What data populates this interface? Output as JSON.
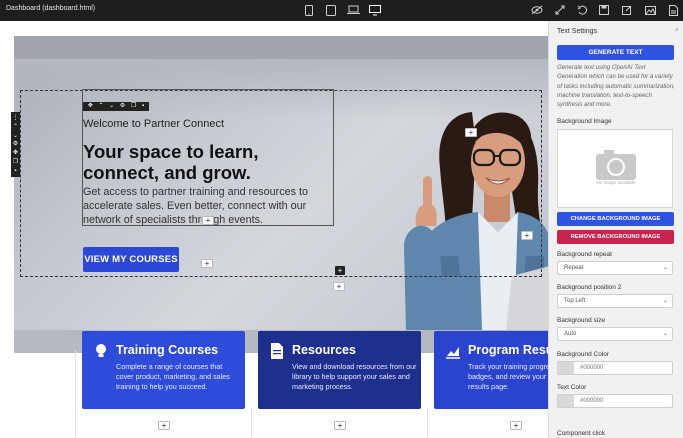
{
  "topbar": {
    "doc_title": "Dashboard (dashboard.html)",
    "device_icons": [
      "mobile-icon",
      "tablet-icon",
      "laptop-icon",
      "desktop-icon"
    ],
    "action_icons": [
      "visibility-icon",
      "fullscreen-icon",
      "undo-icon",
      "save-icon",
      "edit-icon",
      "image-icon",
      "file-icon"
    ]
  },
  "hero": {
    "welcome": "Welcome to Partner Connect",
    "headline": "Your space to learn, connect, and grow.",
    "subtext": "Get access to partner training and resources to accelerate sales. Even better, connect with our network of specialists through events.",
    "cta": "VIEW MY COURSES"
  },
  "cards": [
    {
      "title": "Training Courses",
      "body": "Complete a range of courses that cover product, marketing, and sales training to help you succeed.",
      "icon": "lightbulb-icon",
      "color": "#2f4bd9"
    },
    {
      "title": "Resources",
      "body": "View and download resources from our library to help support your sales and marketing process.",
      "icon": "document-icon",
      "color": "#1f2f8e"
    },
    {
      "title": "Program Results",
      "body": "Track your training progress, view your badges, and review your personal results page.",
      "icon": "chart-icon",
      "color": "#2a44cf"
    }
  ],
  "panel": {
    "title": "Text Settings",
    "generate_btn": "GENERATE TEXT",
    "description": "Generate text using OpenAI Text Generation which can be used for a variety of tasks including automatic summarization, machine translation, text-to-speech synthesis and more.",
    "bg_image_label": "Background Image",
    "no_image": "No image available",
    "change_bg": "CHANGE BACKGROUND IMAGE",
    "remove_bg": "REMOVE BACKGROUND IMAGE",
    "bg_repeat_label": "Background repeat",
    "bg_repeat_value": "Repeat",
    "bg_position_label": "Background position 2",
    "bg_position_value": "Top Left",
    "bg_size_label": "Background size",
    "bg_size_value": "Auto",
    "bg_color_label": "Background Color",
    "bg_color_value": "#000000",
    "text_color_label": "Text Color",
    "text_color_value": "#000000",
    "component_click_label": "Component click"
  },
  "colors": {
    "accent": "#2f52e0",
    "danger": "#c7244f",
    "toolbar": "#1e1e1e"
  }
}
